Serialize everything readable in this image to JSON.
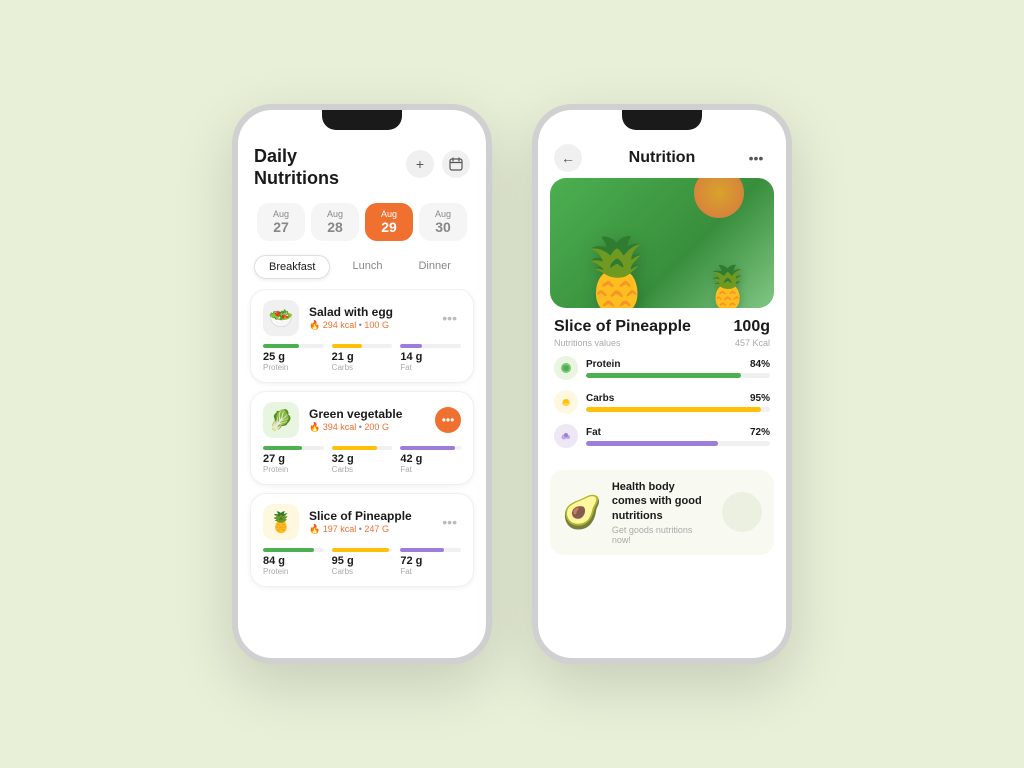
{
  "bg_color": "#e8f0d8",
  "phone1": {
    "title_line1": "Daily",
    "title_line2": "Nutritions",
    "add_label": "+",
    "calendar_label": "📅",
    "dates": [
      {
        "month": "Aug",
        "day": "27",
        "active": false
      },
      {
        "month": "Aug",
        "day": "28",
        "active": false
      },
      {
        "month": "Aug",
        "day": "29",
        "active": true
      },
      {
        "month": "Aug",
        "day": "30",
        "active": false
      }
    ],
    "meal_tabs": [
      {
        "label": "Breakfast",
        "active": true
      },
      {
        "label": "Lunch",
        "active": false
      },
      {
        "label": "Dinner",
        "active": false
      }
    ],
    "food_items": [
      {
        "icon": "🥗",
        "icon_bg": "egg-bg",
        "name": "Salad with egg",
        "kcal": "294 kcal",
        "weight": "100 G",
        "more_style": "plain",
        "nutrients": [
          {
            "value": "25 g",
            "label": "Protein",
            "bar_pct": 60,
            "bar_color": "bar-green"
          },
          {
            "value": "21 g",
            "label": "Carbs",
            "bar_pct": 50,
            "bar_color": "bar-yellow"
          },
          {
            "value": "14 g",
            "label": "Fat",
            "bar_pct": 35,
            "bar_color": "bar-purple"
          }
        ]
      },
      {
        "icon": "🥬",
        "icon_bg": "green-bg",
        "name": "Green vegetable",
        "kcal": "394 kcal",
        "weight": "200 G",
        "more_style": "circle",
        "nutrients": [
          {
            "value": "27 g",
            "label": "Protein",
            "bar_pct": 65,
            "bar_color": "bar-green"
          },
          {
            "value": "32 g",
            "label": "Carbs",
            "bar_pct": 75,
            "bar_color": "bar-yellow"
          },
          {
            "value": "42 g",
            "label": "Fat",
            "bar_pct": 90,
            "bar_color": "bar-purple"
          }
        ]
      },
      {
        "icon": "🍍",
        "icon_bg": "yellow-bg",
        "name": "Slice of Pineapple",
        "kcal": "197 kcal",
        "weight": "247 G",
        "more_style": "plain",
        "nutrients": [
          {
            "value": "84 g",
            "label": "Protein",
            "bar_pct": 84,
            "bar_color": "bar-green"
          },
          {
            "value": "95 g",
            "label": "Carbs",
            "bar_pct": 95,
            "bar_color": "bar-yellow"
          },
          {
            "value": "72 g",
            "label": "Fat",
            "bar_pct": 72,
            "bar_color": "bar-purple"
          }
        ]
      }
    ]
  },
  "phone2": {
    "title": "Nutrition",
    "back_icon": "←",
    "more_icon": "•••",
    "fruit_name": "Slice of Pineapple",
    "fruit_weight": "100g",
    "fruit_subtitle": "Nutritions values",
    "fruit_kcal": "457 Kcal",
    "nutrients": [
      {
        "icon": "🟢",
        "icon_bg": "green-icon",
        "name": "Protein",
        "pct": "84%",
        "pct_num": 84,
        "bar_color": "#4caf50"
      },
      {
        "icon": "🌾",
        "icon_bg": "yellow-icon",
        "name": "Carbs",
        "pct": "95%",
        "pct_num": 95,
        "bar_color": "#ffc107"
      },
      {
        "icon": "🫐",
        "icon_bg": "purple-icon",
        "name": "Fat",
        "pct": "72%",
        "pct_num": 72,
        "bar_color": "#9c7dd9"
      }
    ],
    "promo": {
      "icon": "🥑",
      "title": "Health body comes with good nutritions",
      "subtitle": "Get goods nutritions now!"
    }
  }
}
